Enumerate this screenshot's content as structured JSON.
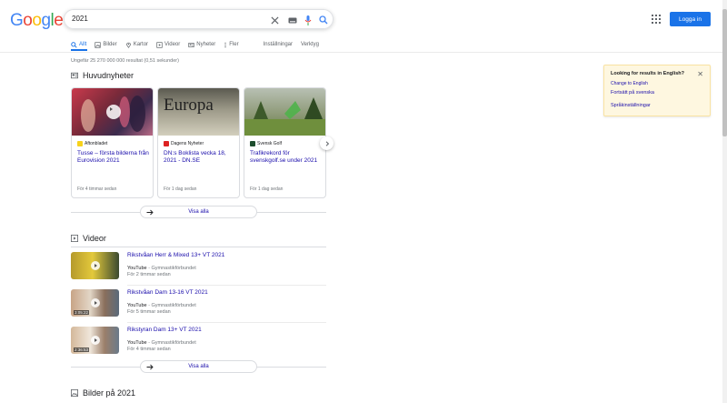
{
  "header": {
    "logo": [
      "G",
      "o",
      "o",
      "g",
      "l",
      "e"
    ],
    "logo_colors": [
      "#4285f4",
      "#ea4335",
      "#fbbc05",
      "#4285f4",
      "#34a853",
      "#ea4335"
    ],
    "query": "2021",
    "login_label": "Logga in"
  },
  "tabs": [
    {
      "label": "Allt",
      "icon": "search-icon"
    },
    {
      "label": "Bilder",
      "icon": "image-icon"
    },
    {
      "label": "Kartor",
      "icon": "map-pin-icon"
    },
    {
      "label": "Videor",
      "icon": "video-icon"
    },
    {
      "label": "Nyheter",
      "icon": "news-icon"
    },
    {
      "label": "Fler",
      "icon": "more-icon"
    },
    {
      "label": "Inställningar",
      "icon": ""
    },
    {
      "label": "Verktyg",
      "icon": ""
    }
  ],
  "stats": "Ungefär 25 270 000 000 resultat (0,51 sekunder)",
  "news": {
    "heading": "Huvudnyheter",
    "cards": [
      {
        "source": "Aftonbladet",
        "title": "Tusse – första bilderna från Eurovision 2021",
        "time": "För 4 timmar sedan"
      },
      {
        "source": "Dagens Nyheter",
        "title": "DN:s Boklista vecka 18, 2021 - DN.SE",
        "time": "För 1 dag sedan",
        "image_text": "Europa"
      },
      {
        "source": "Svensk Golf",
        "title": "Trafikrekord för svenskgolf.se under 2021",
        "time": "För 1 dag sedan"
      }
    ],
    "show_all": "Visa alla"
  },
  "videos": {
    "heading": "Videor",
    "items": [
      {
        "title": "Rikstvåan Herr & Mixed 13+ VT 2021",
        "platform": "YouTube",
        "channel": "Gymnastikförbundet",
        "time": "För 2 timmar sedan",
        "duration": ""
      },
      {
        "title": "Rikstvåan Dam 13-16 VT 2021",
        "platform": "YouTube",
        "channel": "Gymnastikförbundet",
        "time": "För 5 timmar sedan",
        "duration": "3:05:22"
      },
      {
        "title": "Rikstyran Dam 13+ VT 2021",
        "platform": "YouTube",
        "channel": "Gymnastikförbundet",
        "time": "För 4 timmar sedan",
        "duration": "2:36:53"
      }
    ],
    "show_all": "Visa alla"
  },
  "images": {
    "heading": "Bilder på 2021"
  },
  "language": {
    "question": "Looking for results in English?",
    "change": "Change to English",
    "continue": "Fortsätt på svenska",
    "settings": "Språkinställningar"
  },
  "colors": {
    "accent": "#1a73e8",
    "link": "#1a0dab",
    "notice_bg": "#fef7e0"
  }
}
